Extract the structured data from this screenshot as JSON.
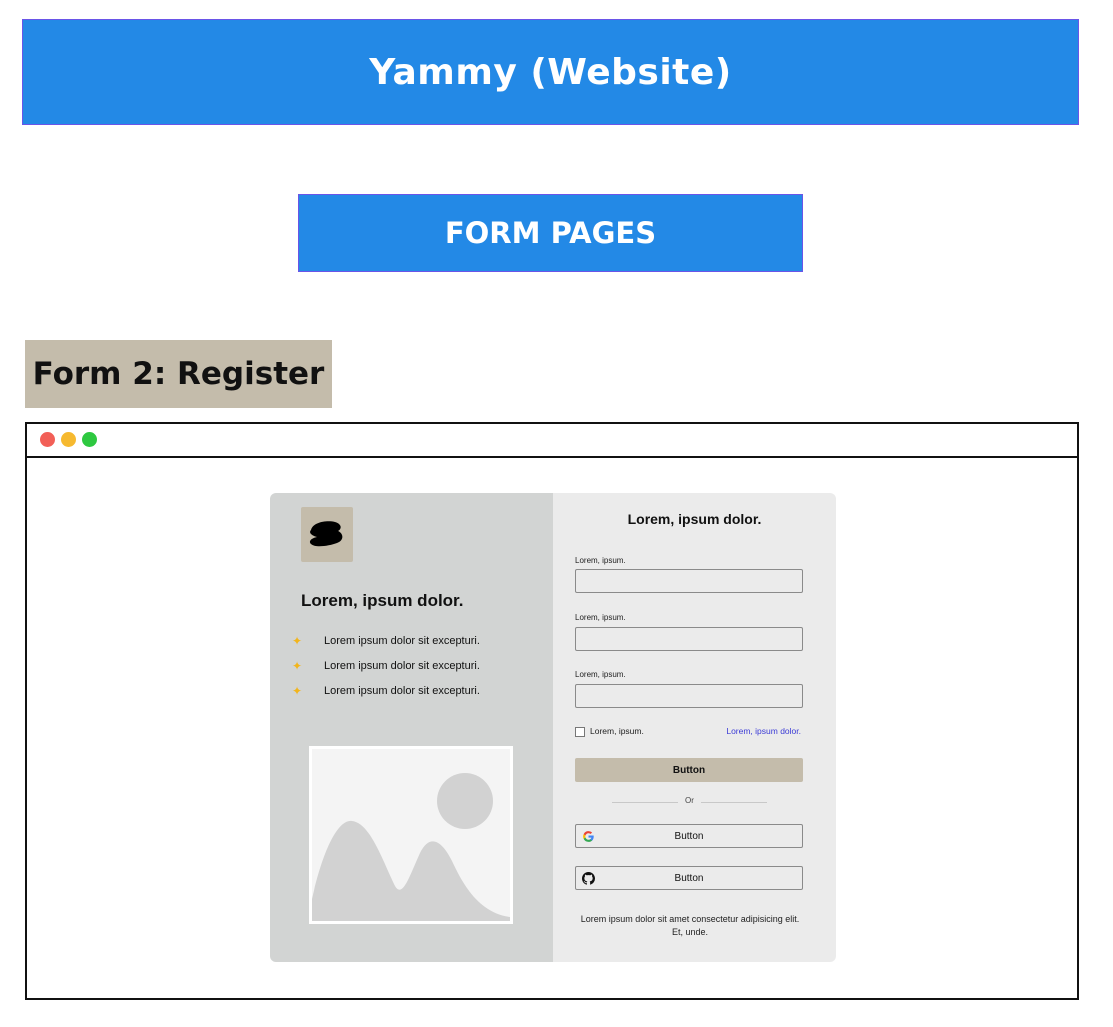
{
  "header": {
    "title": "Yammy (Website)"
  },
  "section": {
    "title": "FORM PAGES"
  },
  "form_label": "Form 2: Register",
  "colors": {
    "banner_bg": "#2389e6",
    "accent_tan": "#c4bcab",
    "left_panel": "#d2d4d3",
    "right_panel": "#ebebeb",
    "link": "#3b3bd6",
    "sparkle": "#f2b51c",
    "window_dots": [
      "#f25f57",
      "#f6b92f",
      "#2ec840"
    ]
  },
  "card": {
    "left": {
      "logo_icon": "blob-logo-icon",
      "heading": "Lorem, ipsum dolor.",
      "features": [
        "Lorem ipsum dolor sit excepturi.",
        "Lorem ipsum dolor sit excepturi.",
        "Lorem ipsum dolor sit excepturi."
      ],
      "image_icon": "image-placeholder-icon"
    },
    "right": {
      "heading": "Lorem, ipsum dolor.",
      "fields": [
        {
          "label": "Lorem, ipsum.",
          "value": ""
        },
        {
          "label": "Lorem, ipsum.",
          "value": ""
        },
        {
          "label": "Lorem, ipsum.",
          "value": ""
        }
      ],
      "checkbox_label": "Lorem, ipsum.",
      "link_text": "Lorem, ipsum dolor.",
      "primary_button": "Button",
      "divider_text": "Or",
      "google_button": "Button",
      "github_button": "Button",
      "footer": "Lorem ipsum dolor sit amet consectetur adipisicing elit. Et, unde."
    }
  }
}
